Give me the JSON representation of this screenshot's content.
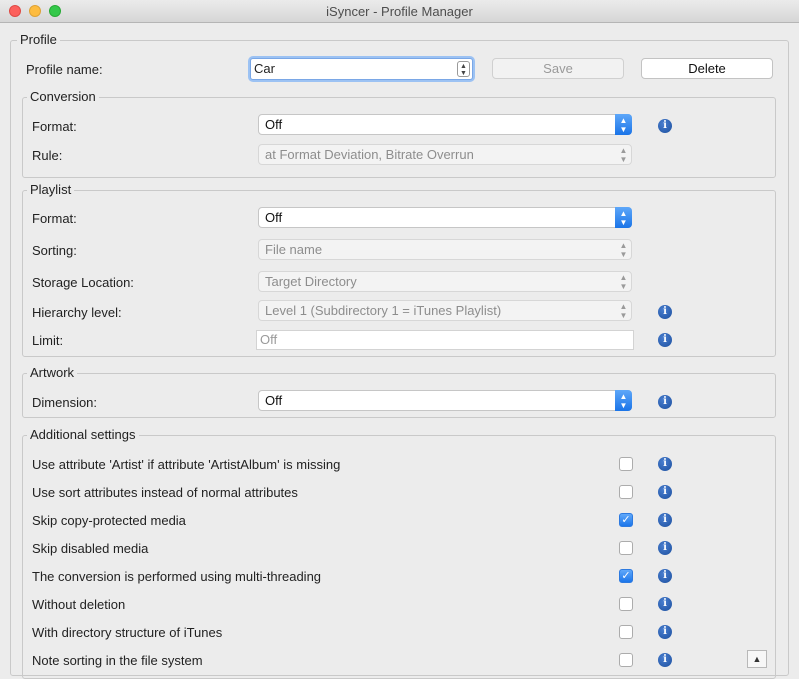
{
  "window": {
    "title": "iSyncer - Profile Manager"
  },
  "profile": {
    "legend": "Profile",
    "name_label": "Profile name:",
    "name_value": "Car",
    "save_label": "Save",
    "delete_label": "Delete"
  },
  "conversion": {
    "legend": "Conversion",
    "format_label": "Format:",
    "format_value": "Off",
    "rule_label": "Rule:",
    "rule_value": "at Format Deviation, Bitrate Overrun"
  },
  "playlist": {
    "legend": "Playlist",
    "format_label": "Format:",
    "format_value": "Off",
    "sorting_label": "Sorting:",
    "sorting_value": "File name",
    "storage_label": "Storage Location:",
    "storage_value": "Target Directory",
    "hierarchy_label": "Hierarchy level:",
    "hierarchy_value": "Level 1 (Subdirectory 1 = iTunes Playlist)",
    "limit_label": "Limit:",
    "limit_placeholder": "Off"
  },
  "artwork": {
    "legend": "Artwork",
    "dimension_label": "Dimension:",
    "dimension_value": "Off"
  },
  "additional": {
    "legend": "Additional settings",
    "items": [
      {
        "label": "Use attribute 'Artist' if attribute 'ArtistAlbum' is missing",
        "checked": false
      },
      {
        "label": "Use sort attributes instead of normal attributes",
        "checked": false
      },
      {
        "label": "Skip copy-protected media",
        "checked": true
      },
      {
        "label": "Skip disabled media",
        "checked": false
      },
      {
        "label": "The conversion is performed using multi-threading",
        "checked": true
      },
      {
        "label": "Without deletion",
        "checked": false
      },
      {
        "label": "With directory structure of iTunes",
        "checked": false
      },
      {
        "label": "Note sorting in the file system",
        "checked": false
      }
    ]
  },
  "icons": {
    "info": "info-icon",
    "check": "✓",
    "up_down": "⌃⌄",
    "scroll_up": "▲"
  },
  "colors": {
    "accent": "#1a74e8",
    "info": "#1c4f9e",
    "close": "#fc605c",
    "minimize": "#fdbc40",
    "maximize": "#34c84a"
  }
}
